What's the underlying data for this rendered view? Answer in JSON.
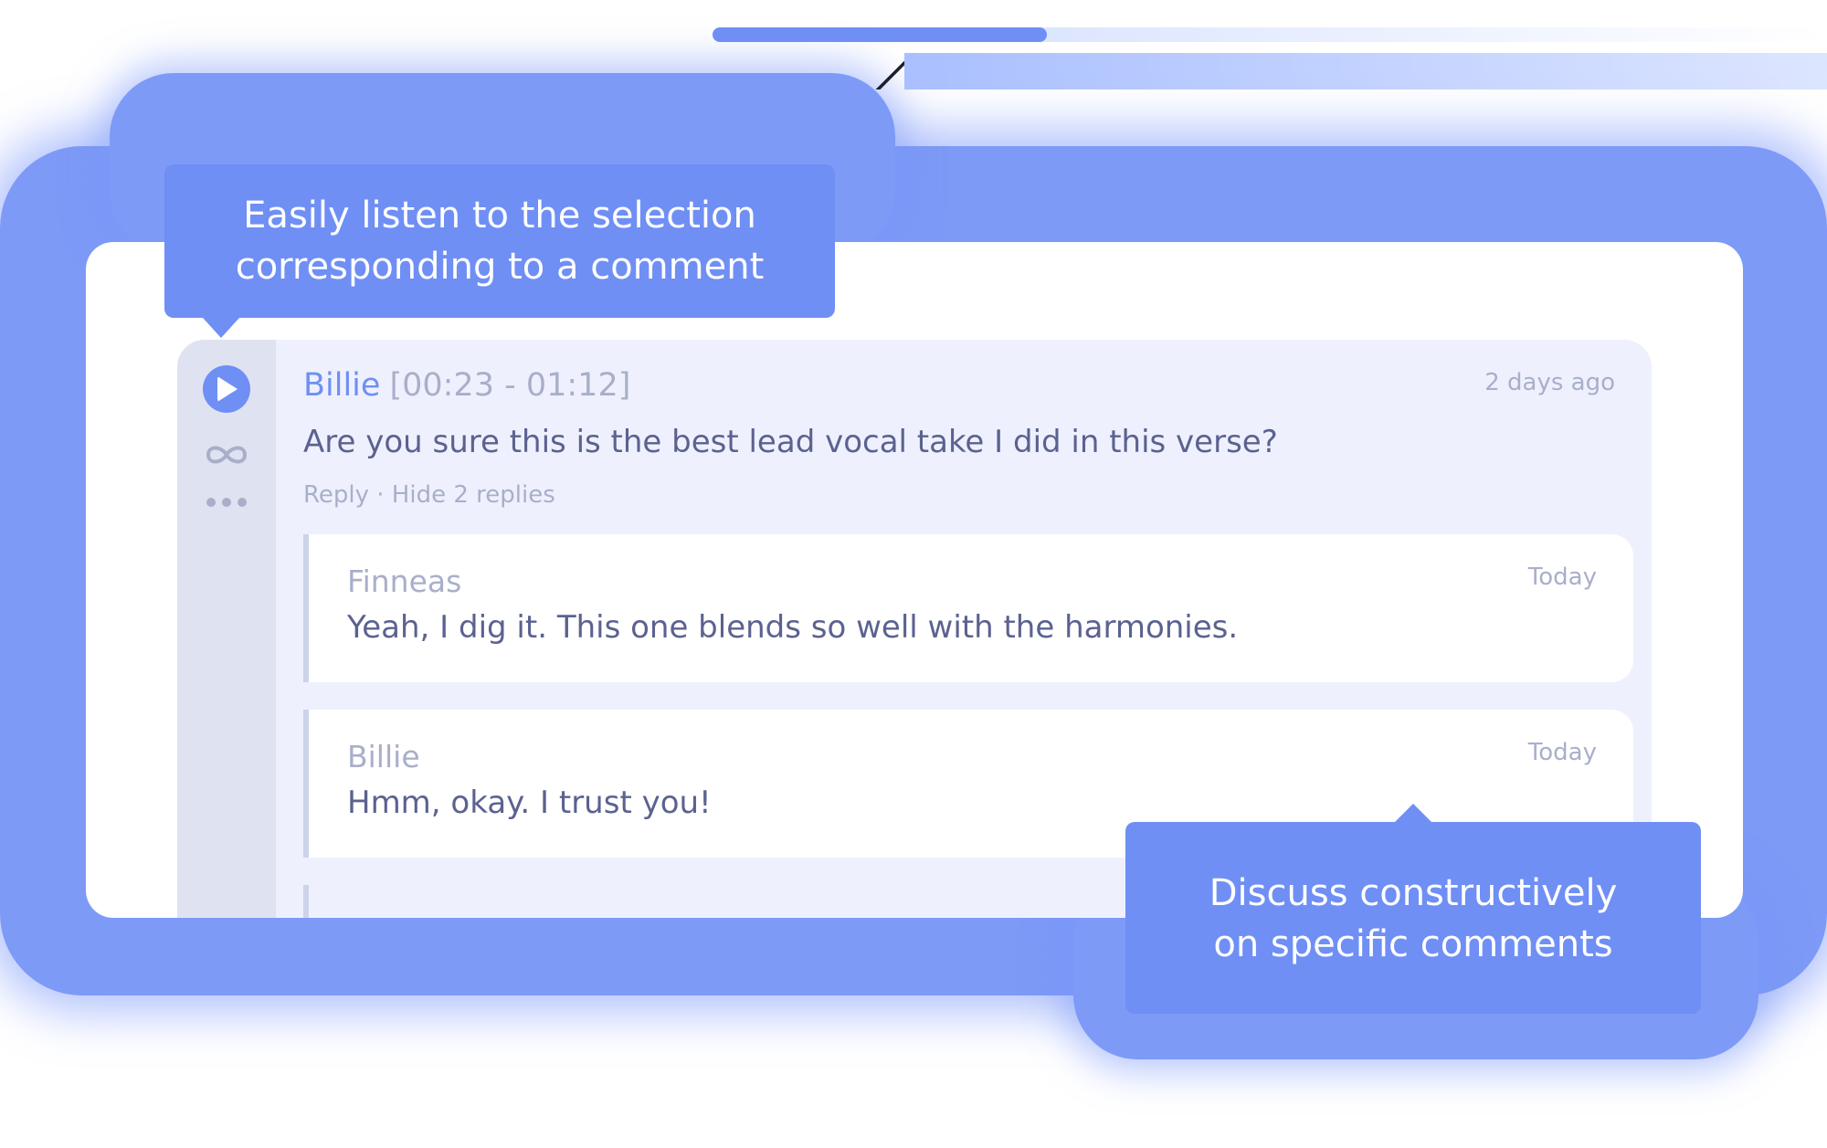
{
  "callouts": {
    "top": {
      "line1": "Easily listen to the selection",
      "line2": "corresponding to a comment"
    },
    "bottom": {
      "line1": "Discuss constructively",
      "line2": "on specific comments"
    }
  },
  "progress": {
    "fraction": 0.3
  },
  "rail": {
    "icons": [
      "play-icon",
      "loop-icon",
      "more-icon"
    ]
  },
  "comment": {
    "author": "Billie",
    "range": "[00:23 - 01:12]",
    "time": "2 days ago",
    "body": "Are you sure this is the best lead vocal take I did in this verse?",
    "actions": "Reply · Hide 2 replies"
  },
  "replies": [
    {
      "author": "Finneas",
      "time": "Today",
      "body": "Yeah, I dig it. This one blends so well with the harmonies."
    },
    {
      "author": "Billie",
      "time": "Today",
      "body": "Hmm, okay. I trust you!"
    }
  ],
  "colors": {
    "accent": "#6f8ff5",
    "muted_text": "#a9afca",
    "body_text": "#5b6290",
    "thread_bg": "#eef1fd",
    "rail_bg": "#dfe3f1"
  }
}
